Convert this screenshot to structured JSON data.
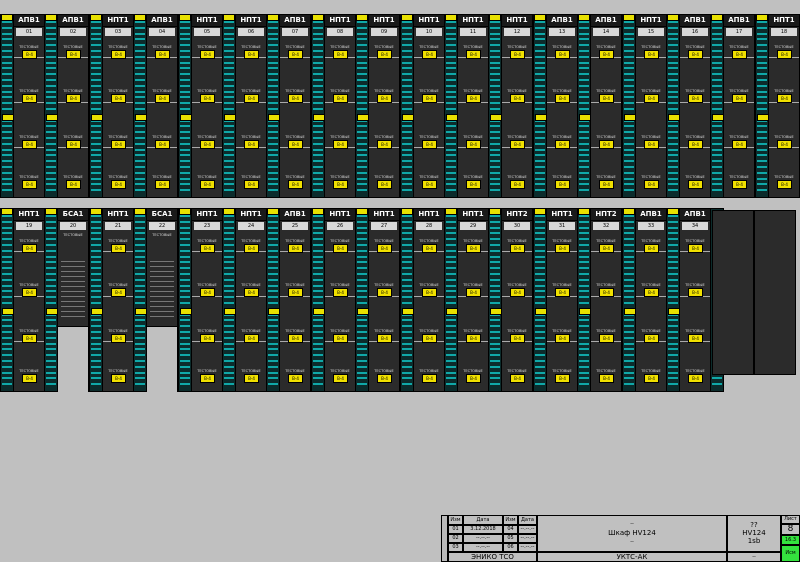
{
  "modules_row1": [
    {
      "type": "АПВ1",
      "num": "01"
    },
    {
      "type": "АПВ1",
      "num": "02"
    },
    {
      "type": "НПТ1",
      "num": "03"
    },
    {
      "type": "АПВ1",
      "num": "04"
    },
    {
      "type": "НПТ1",
      "num": "05"
    },
    {
      "type": "НПТ1",
      "num": "06"
    },
    {
      "type": "АПВ1",
      "num": "07"
    },
    {
      "type": "НПТ1",
      "num": "08"
    },
    {
      "type": "НПТ1",
      "num": "09"
    },
    {
      "type": "НПТ1",
      "num": "10"
    },
    {
      "type": "НПТ1",
      "num": "11"
    },
    {
      "type": "НПТ1",
      "num": "12"
    },
    {
      "type": "АПВ1",
      "num": "13"
    },
    {
      "type": "АПВ1",
      "num": "14"
    },
    {
      "type": "НПТ1",
      "num": "15"
    },
    {
      "type": "АПВ1",
      "num": "16"
    },
    {
      "type": "АПВ1",
      "num": "17"
    },
    {
      "type": "НПТ1",
      "num": "18"
    }
  ],
  "modules_row2": [
    {
      "type": "НПТ1",
      "num": "19"
    },
    {
      "type": "БСА1",
      "num": "20"
    },
    {
      "type": "НПТ1",
      "num": "21"
    },
    {
      "type": "БСА1",
      "num": "22"
    },
    {
      "type": "НПТ1",
      "num": "23"
    },
    {
      "type": "НПТ1",
      "num": "24"
    },
    {
      "type": "АПВ1",
      "num": "25"
    },
    {
      "type": "НПТ1",
      "num": "26"
    },
    {
      "type": "НПТ1",
      "num": "27"
    },
    {
      "type": "НПТ1",
      "num": "28"
    },
    {
      "type": "НПТ1",
      "num": "29"
    },
    {
      "type": "НПТ2",
      "num": "30"
    },
    {
      "type": "НПТ1",
      "num": "31"
    },
    {
      "type": "НПТ2",
      "num": "32"
    },
    {
      "type": "АПВ1",
      "num": "33"
    },
    {
      "type": "АПВ1",
      "num": "34"
    }
  ],
  "title_block": {
    "col_izm": "Изм",
    "col_data": "Дата",
    "col_izm2": "Изм",
    "col_data2": "Дата",
    "rows": [
      {
        "izm": "01",
        "data": "3.12.2018",
        "izm2": "04",
        "data2": "--.--.--"
      },
      {
        "izm": "02",
        "data": "--.--.--",
        "izm2": "05",
        "data2": "--.--.--"
      },
      {
        "izm": "03",
        "data": "--.--.--",
        "izm2": "06",
        "data2": "--.--.--"
      }
    ],
    "company": "ЭНИКО ТСО",
    "center_top": "--",
    "center_title": "Шкаф HV124",
    "center_bottom": "--",
    "system": "УКТС-АК",
    "code_top": "??",
    "code_mid": "HV124",
    "code_sub": "1sb",
    "code_bottom": "--",
    "sheet_label": "Лист",
    "sheet_num": "8",
    "green_label": "Исм",
    "green_date": "16.3"
  },
  "yellow_badge": "В-4",
  "label_text": "ТЕСТОВЫЕ"
}
